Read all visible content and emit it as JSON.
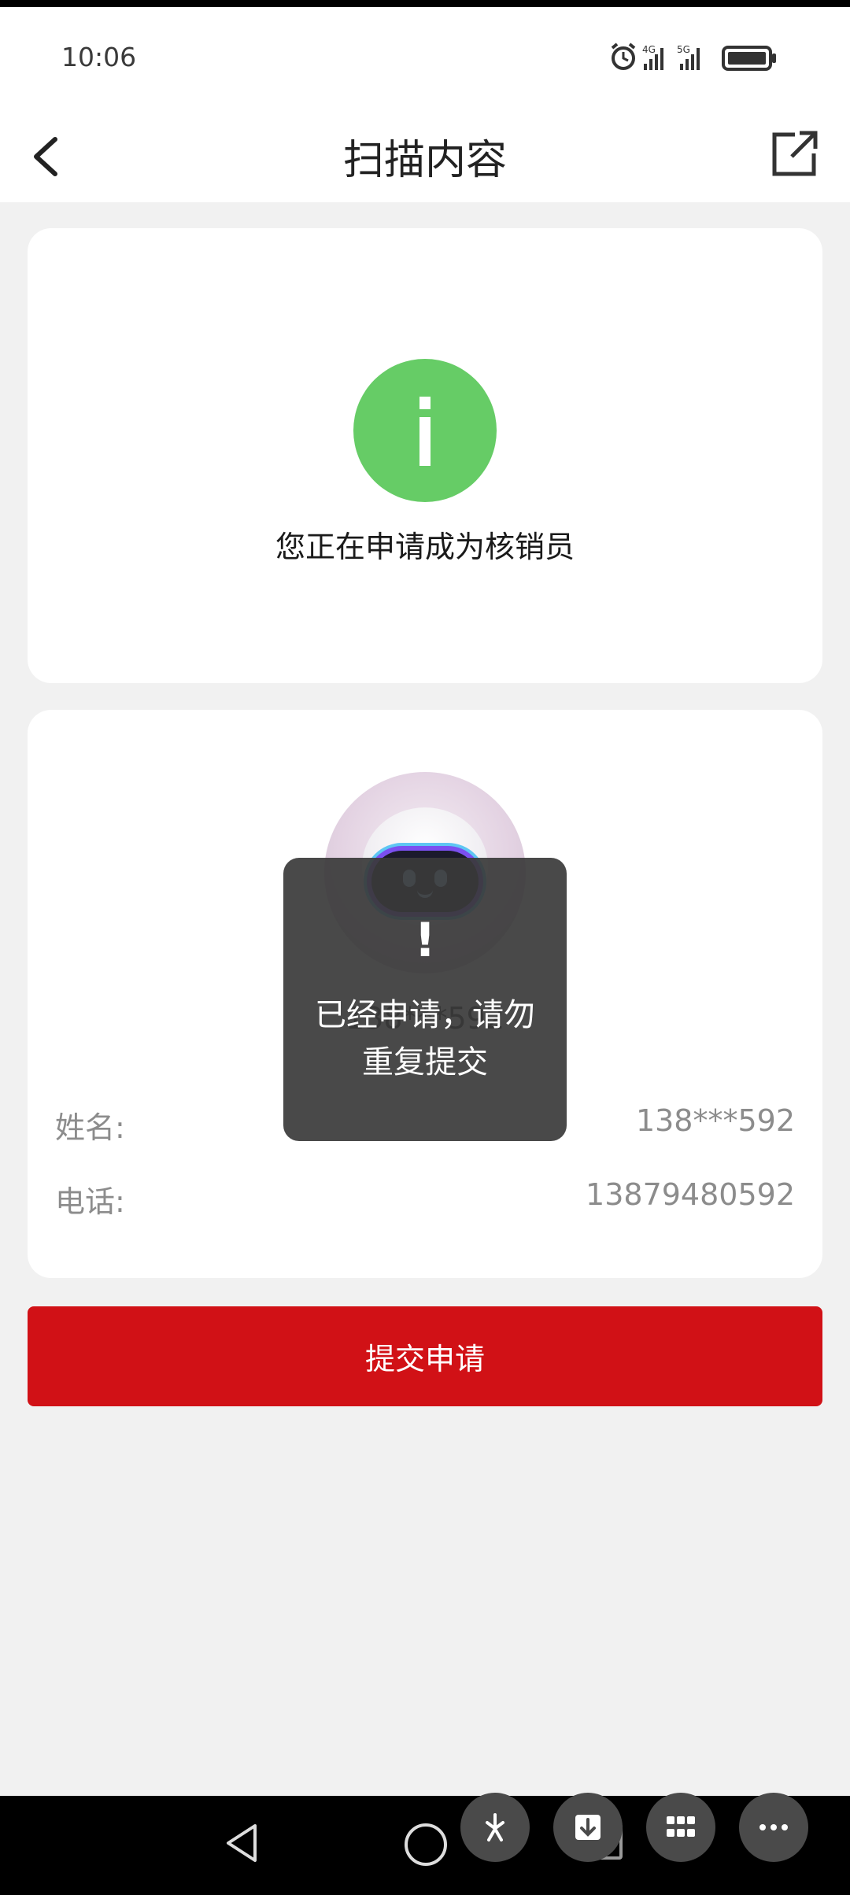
{
  "status_bar": {
    "time": "10:06",
    "network_1": "4G",
    "network_2": "5G"
  },
  "nav": {
    "title": "扫描内容",
    "back_icon": "chevron-left-icon",
    "share_icon": "share-external-icon"
  },
  "info_card": {
    "icon_glyph": "i",
    "icon_color": "#66cc66",
    "message": "您正在申请成为核销员"
  },
  "user_card": {
    "avatar_name": "138***592",
    "fields": [
      {
        "label": "姓名:",
        "value": "138***592"
      },
      {
        "label": "电话:",
        "value": "13879480592"
      }
    ]
  },
  "submit_button": {
    "label": "提交申请",
    "color": "#d11116"
  },
  "toast": {
    "icon": "!",
    "message": "已经申请，请勿重复提交"
  }
}
